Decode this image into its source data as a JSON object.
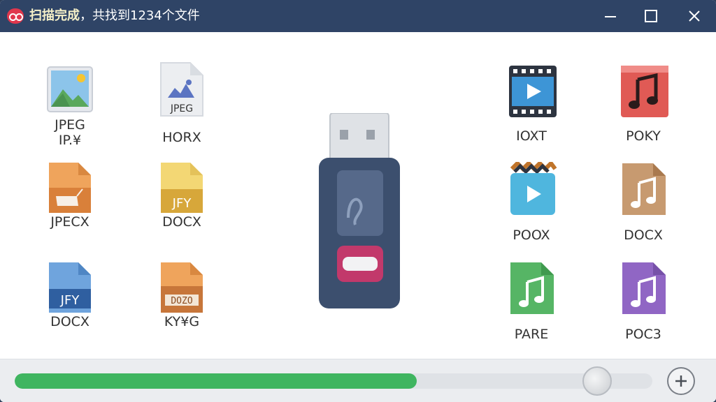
{
  "window": {
    "title_bold": "扫描完成",
    "title_rest": "，共找到1234个文件"
  },
  "files": [
    {
      "id": "f1",
      "icon": "image-landscape-icon",
      "label1": "JPEG",
      "label2": "IP.¥"
    },
    {
      "id": "f2",
      "icon": "image-document-icon",
      "label1": "",
      "label2": "HORX",
      "badge": "JPEG"
    },
    {
      "id": "f3",
      "icon": "orange-document-icon",
      "label1": "",
      "label2": "JPECX"
    },
    {
      "id": "f4",
      "icon": "yellow-document-icon",
      "label1": "",
      "label2": "DOCX",
      "badge": "JFY"
    },
    {
      "id": "f5",
      "icon": "blue-document-icon",
      "label1": "",
      "label2": "DOCX",
      "badge": "JFY"
    },
    {
      "id": "f6",
      "icon": "orange-archive-icon",
      "label1": "",
      "label2": "KY¥G",
      "badge": "DOZO"
    },
    {
      "id": "f7",
      "icon": "video-film-icon",
      "label1": "",
      "label2": "IOXT"
    },
    {
      "id": "f8",
      "icon": "red-music-icon",
      "label1": "",
      "label2": "POKY"
    },
    {
      "id": "f9",
      "icon": "video-bucket-icon",
      "label1": "",
      "label2": "POOX"
    },
    {
      "id": "f10",
      "icon": "brown-music-icon",
      "label1": "",
      "label2": "DOCX"
    },
    {
      "id": "f11",
      "icon": "green-music-icon",
      "label1": "",
      "label2": "PARE"
    },
    {
      "id": "f12",
      "icon": "purple-music-icon",
      "label1": "",
      "label2": "POC3"
    }
  ],
  "progress": {
    "value_percent": 63
  },
  "colors": {
    "titlebar": "#2f4466",
    "progress": "#3fb560",
    "usb_body": "#3c4f6e",
    "usb_accent": "#c2396b"
  }
}
